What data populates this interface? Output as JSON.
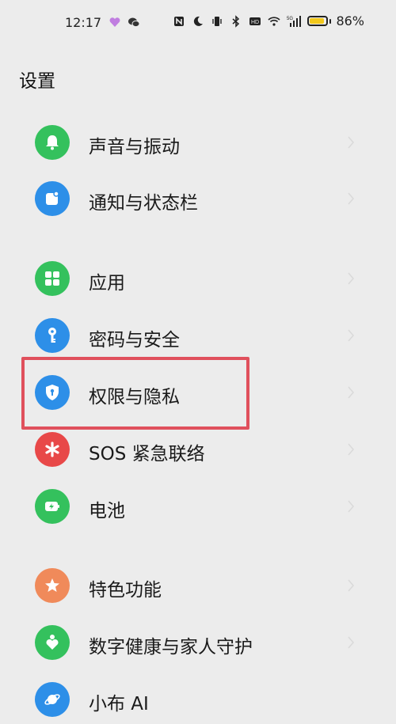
{
  "status_bar": {
    "time": "12:17",
    "battery_percent": "86%",
    "battery_level": 0.86,
    "battery_color": "#f2c81c",
    "network": "5G",
    "left_icons": [
      "heart-app-icon",
      "wechat-icon"
    ],
    "right_icons": [
      "nfc-icon",
      "moon-icon",
      "vibrate-icon",
      "bluetooth-icon",
      "hd-icon",
      "wifi-icon",
      "signal-icon",
      "battery-icon"
    ]
  },
  "page": {
    "title": "设置"
  },
  "menu": {
    "items": [
      {
        "label": "声音与振动",
        "icon": "bell-icon",
        "color": "#34c15d"
      },
      {
        "label": "通知与状态栏",
        "icon": "notification-icon",
        "color": "#2d8fe8"
      },
      {
        "label": "应用",
        "icon": "apps-grid-icon",
        "color": "#34c15d"
      },
      {
        "label": "密码与安全",
        "icon": "key-icon",
        "color": "#2d8fe8"
      },
      {
        "label": "权限与隐私",
        "icon": "shield-lock-icon",
        "color": "#2d8fe8"
      },
      {
        "label": "SOS 紧急联络",
        "icon": "asterisk-icon",
        "color": "#e84848"
      },
      {
        "label": "电池",
        "icon": "battery-charge-icon",
        "color": "#34c15d"
      },
      {
        "label": "特色功能",
        "icon": "star-icon",
        "color": "#f08a5a"
      },
      {
        "label": "数字健康与家人守护",
        "icon": "family-heart-icon",
        "color": "#34c15d"
      },
      {
        "label": "小布 AI",
        "icon": "ai-assistant-icon",
        "color": "#2d8fe8"
      }
    ]
  },
  "annotation": {
    "highlighted_item": "权限与隐私",
    "color": "#e0505c"
  }
}
